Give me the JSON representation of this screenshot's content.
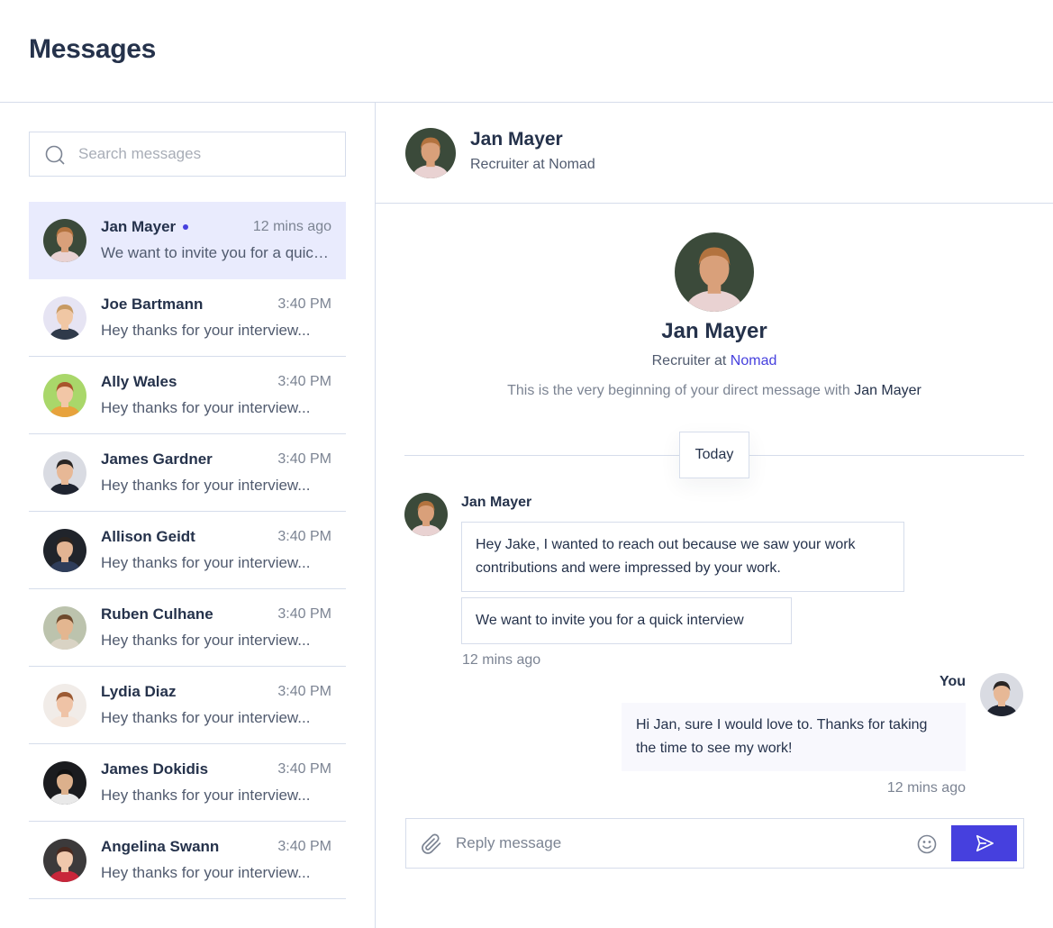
{
  "page": {
    "title": "Messages"
  },
  "search": {
    "placeholder": "Search messages"
  },
  "conversations": [
    {
      "name": "Jan Mayer",
      "time": "12 mins ago",
      "preview": "We want to invite you for a quick interview",
      "active": true,
      "online": true,
      "avatar": {
        "bg": "#3b4a3a",
        "skin": "#d9a07a",
        "hair": "#b3733f",
        "shirt": "#e9d2d2"
      }
    },
    {
      "name": "Joe Bartmann",
      "time": "3:40 PM",
      "preview": "Hey thanks for your interview...",
      "avatar": {
        "bg": "#e6e4f3",
        "skin": "#f0c7a4",
        "hair": "#c79a63",
        "shirt": "#2f3a4a"
      }
    },
    {
      "name": "Ally Wales",
      "time": "3:40 PM",
      "preview": "Hey thanks for your interview...",
      "avatar": {
        "bg": "#a9d76a",
        "skin": "#f2c6a6",
        "hair": "#a8552c",
        "shirt": "#e7a23c"
      }
    },
    {
      "name": "James Gardner",
      "time": "3:40 PM",
      "preview": "Hey thanks for your interview...",
      "avatar": {
        "bg": "#d9dbe2",
        "skin": "#e7b896",
        "hair": "#2a2624",
        "shirt": "#1f2430"
      }
    },
    {
      "name": "Allison Geidt",
      "time": "3:40 PM",
      "preview": "Hey thanks for your interview...",
      "avatar": {
        "bg": "#20242b",
        "skin": "#e2b493",
        "hair": "#2b2420",
        "shirt": "#2f3d5a"
      }
    },
    {
      "name": "Ruben Culhane",
      "time": "3:40 PM",
      "preview": "Hey thanks for your interview...",
      "avatar": {
        "bg": "#bcc3ad",
        "skin": "#e3b690",
        "hair": "#6e4a2d",
        "shirt": "#d9d3c4"
      }
    },
    {
      "name": "Lydia Diaz",
      "time": "3:40 PM",
      "preview": "Hey thanks for your interview...",
      "avatar": {
        "bg": "#f1ece8",
        "skin": "#efc3a6",
        "hair": "#9c5a33",
        "shirt": "#f4e6dc"
      }
    },
    {
      "name": "James Dokidis",
      "time": "3:40 PM",
      "preview": "Hey thanks for your interview...",
      "avatar": {
        "bg": "#1b1c1f",
        "skin": "#dcb08c",
        "hair": "#121212",
        "shirt": "#e9e9e9"
      }
    },
    {
      "name": "Angelina Swann",
      "time": "3:40 PM",
      "preview": "Hey thanks for your interview...",
      "avatar": {
        "bg": "#3c3a3b",
        "skin": "#f0c8ac",
        "hair": "#4a2a20",
        "shirt": "#c8263a"
      }
    }
  ],
  "chat": {
    "contact_name": "Jan Mayer",
    "contact_role": "Recruiter at Nomad",
    "intro": {
      "name": "Jan Mayer",
      "role_prefix": "Recruiter at",
      "company": "Nomad",
      "note_prefix": "This is the very beginning of your direct message with",
      "note_name": "Jan Mayer"
    },
    "day_label": "Today",
    "incoming": {
      "sender": "Jan Mayer",
      "messages": [
        "Hey Jake, I wanted to reach out because we saw your work contributions and were impressed by your work.",
        "We want to invite you for a quick interview"
      ],
      "time": "12 mins ago"
    },
    "outgoing": {
      "sender": "You",
      "message": "Hi Jan, sure I would love to. Thanks for taking the time to see my work!",
      "time": "12 mins ago",
      "avatar": {
        "bg": "#d9dbe2",
        "skin": "#e7b896",
        "hair": "#2a2624",
        "shirt": "#1f2430"
      }
    },
    "reply_placeholder": "Reply message"
  },
  "colors": {
    "accent": "#4640DE",
    "active_row": "#E9EBFD",
    "border": "#D6DDEB",
    "text_dark": "#25324B",
    "text_muted": "#7C8493",
    "outgoing_bubble": "#F8F8FD"
  },
  "icons": {
    "search": "search-icon",
    "attach": "paperclip-icon",
    "emoji": "smiley-icon",
    "send": "send-icon"
  }
}
